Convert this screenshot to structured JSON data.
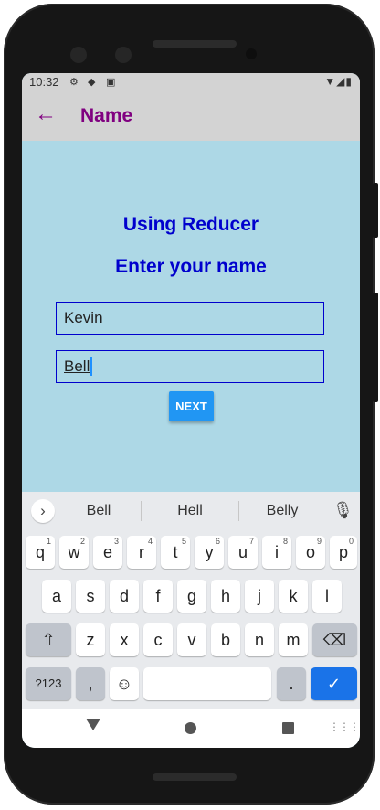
{
  "status_bar": {
    "time": "10:32",
    "icons": [
      "gear-icon",
      "location-a-icon",
      "notification-a-icon"
    ],
    "right_icons": [
      "wifi-icon",
      "signal-icon",
      "battery-icon"
    ]
  },
  "header": {
    "title": "Name",
    "back_icon": "arrow-left-icon",
    "color": "#800080"
  },
  "main": {
    "heading": "Using Reducer",
    "subheading": "Enter your name",
    "first_name_value": "Kevin",
    "last_name_value": "Bell",
    "next_label": "NEXT",
    "background": "#add8e6",
    "accent": "#0000cd",
    "button_color": "#2196f3"
  },
  "keyboard": {
    "suggestions": [
      "Bell",
      "Hell",
      "Belly"
    ],
    "row1": [
      {
        "k": "q",
        "n": "1"
      },
      {
        "k": "w",
        "n": "2"
      },
      {
        "k": "e",
        "n": "3"
      },
      {
        "k": "r",
        "n": "4"
      },
      {
        "k": "t",
        "n": "5"
      },
      {
        "k": "y",
        "n": "6"
      },
      {
        "k": "u",
        "n": "7"
      },
      {
        "k": "i",
        "n": "8"
      },
      {
        "k": "o",
        "n": "9"
      },
      {
        "k": "p",
        "n": "0"
      }
    ],
    "row2": [
      "a",
      "s",
      "d",
      "f",
      "g",
      "h",
      "j",
      "k",
      "l"
    ],
    "row3": [
      "z",
      "x",
      "c",
      "v",
      "b",
      "n",
      "m"
    ],
    "symbols_label": "?123",
    "comma": ",",
    "period": ".",
    "icons": [
      "shift-icon",
      "backspace-icon",
      "emoji-icon",
      "enter-check-icon",
      "mic-icon",
      "chevron-right-icon"
    ]
  }
}
